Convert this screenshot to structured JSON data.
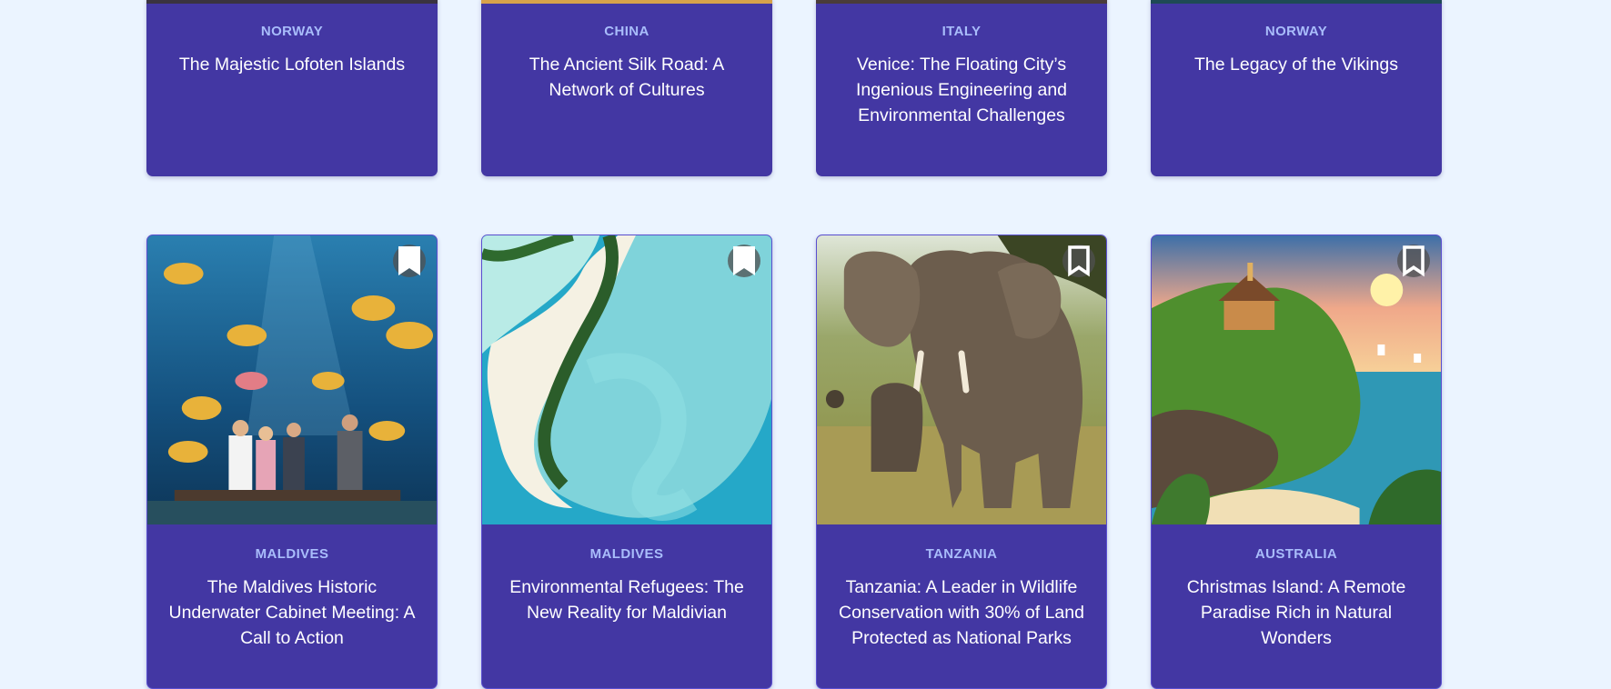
{
  "row1": [
    {
      "country": "NORWAY",
      "title": "The Majestic Lofoten Islands"
    },
    {
      "country": "CHINA",
      "title": "The Ancient Silk Road: A Network of Cultures"
    },
    {
      "country": "ITALY",
      "title": "Venice: The Floating City’s Ingenious Engineering and Environmental Challenges"
    },
    {
      "country": "NORWAY",
      "title": "The Legacy of the Vikings"
    }
  ],
  "row2": [
    {
      "country": "MALDIVES",
      "title": "The Maldives Historic Underwater Cabinet Meeting: A Call to Action",
      "icon": "bookmark-filled-icon"
    },
    {
      "country": "MALDIVES",
      "title": "Environmental Refugees: The New Reality for Maldivian",
      "icon": "bookmark-filled-icon"
    },
    {
      "country": "TANZANIA",
      "title": "Tanzania: A Leader in Wildlife Conservation with 30% of Land Protected as National Parks",
      "icon": "bookmark-outline-icon"
    },
    {
      "country": "AUSTRALIA",
      "title": "Christmas Island: A Remote Paradise Rich in Natural Wonders",
      "icon": "bookmark-outline-icon"
    }
  ],
  "colors": {
    "card": "#4337a3",
    "country": "#a9bdfb",
    "background": "#ebf4ff"
  }
}
